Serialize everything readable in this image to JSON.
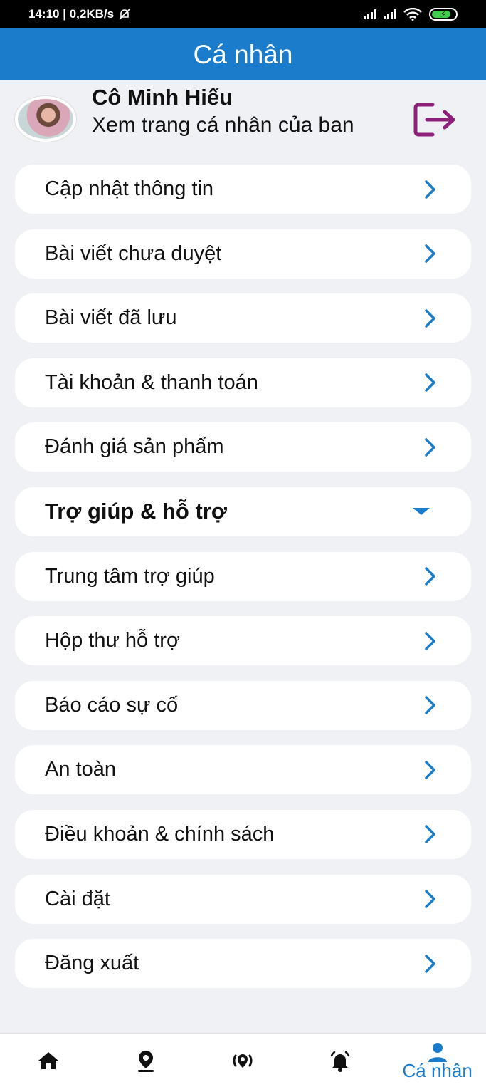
{
  "status_bar": {
    "time_speed": "14:10 | 0,2KB/s"
  },
  "header": {
    "title": "Cá nhân"
  },
  "profile": {
    "name": "Cô Minh Hiếu",
    "subtitle": "Xem trang cá nhân của ban"
  },
  "menu": {
    "items": [
      {
        "label": "Cập nhật thông tin"
      },
      {
        "label": "Bài viết chưa duyệt"
      },
      {
        "label": "Bài viết đã lưu"
      },
      {
        "label": "Tài khoản & thanh toán"
      },
      {
        "label": "Đánh giá sản phẩm"
      },
      {
        "label": "Trợ giúp & hỗ trợ"
      },
      {
        "label": "Trung tâm trợ giúp"
      },
      {
        "label": "Hộp thư hỗ trợ"
      },
      {
        "label": "Báo cáo sự cố"
      },
      {
        "label": "An toàn"
      },
      {
        "label": "Điều khoản & chính sách"
      },
      {
        "label": "Cài đặt"
      },
      {
        "label": "Đăng xuất"
      }
    ]
  },
  "bottom_nav": {
    "active_label": "Cá nhân",
    "icons": [
      "home-icon",
      "location-pin-icon",
      "radar-icon",
      "bell-icon",
      "person-icon"
    ]
  },
  "colors": {
    "accent": "#1a7ccb",
    "logout_icon": "#8e1f7a",
    "background": "#f0f1f5"
  }
}
